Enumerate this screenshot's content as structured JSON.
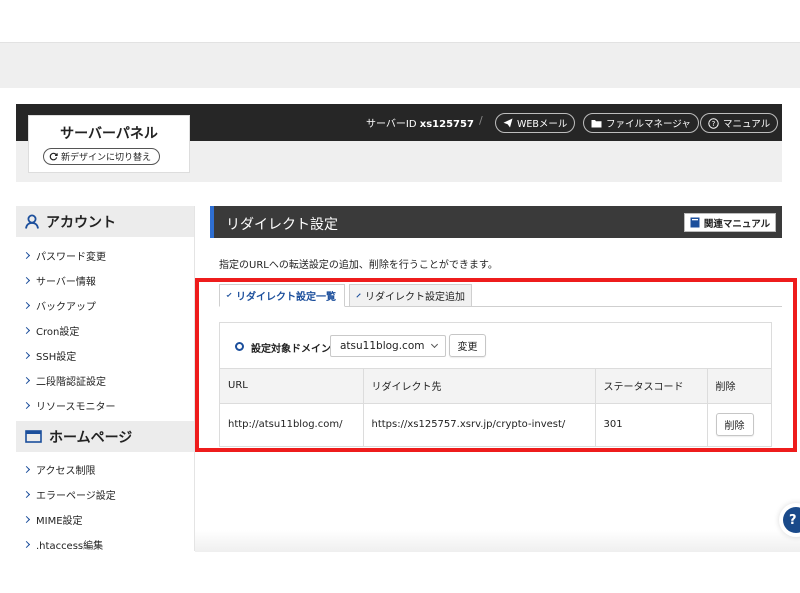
{
  "header": {
    "panel_title": "サーバーパネル",
    "new_design_label": "新デザインに切り替え",
    "server_id_label": "サーバーID",
    "server_id_value": "xs125757",
    "separator": "/",
    "webmail_label": "WEBメール",
    "filemanager_label": "ファイルマネージャ",
    "manual_label": "マニュアル"
  },
  "sidebar": {
    "sections": [
      {
        "title": "アカウント",
        "icon": "user-icon",
        "items": [
          "パスワード変更",
          "サーバー情報",
          "バックアップ",
          "Cron設定",
          "SSH設定",
          "二段階認証設定",
          "リソースモニター"
        ]
      },
      {
        "title": "ホームページ",
        "icon": "window-icon",
        "items": [
          "アクセス制限",
          "エラーページ設定",
          "MIME設定",
          ".htaccess編集"
        ]
      }
    ]
  },
  "main": {
    "title": "リダイレクト設定",
    "related_manual_label": "関連マニュアル",
    "description": "指定のURLへの転送設定の追加、削除を行うことができます。",
    "tabs": [
      {
        "label": "リダイレクト設定一覧",
        "active": true
      },
      {
        "label": "リダイレクト設定追加",
        "active": false
      }
    ],
    "domain_label": "設定対象ドメイン",
    "domain_selected": "atsu11blog.com",
    "change_button": "変更",
    "table": {
      "headers": [
        "URL",
        "リダイレクト先",
        "ステータスコード",
        "削除"
      ],
      "rows": [
        {
          "url": "http://atsu11blog.com/",
          "target": "https://xs125757.xsrv.jp/crypto-invest/",
          "status": "301",
          "delete_label": "削除"
        }
      ]
    }
  },
  "help": {
    "label": "?"
  },
  "colors": {
    "accent_blue": "#1c4f9c",
    "dark_bar": "#262626",
    "highlight_red": "#ee1c1c",
    "main_header": "#3a3a3a"
  }
}
